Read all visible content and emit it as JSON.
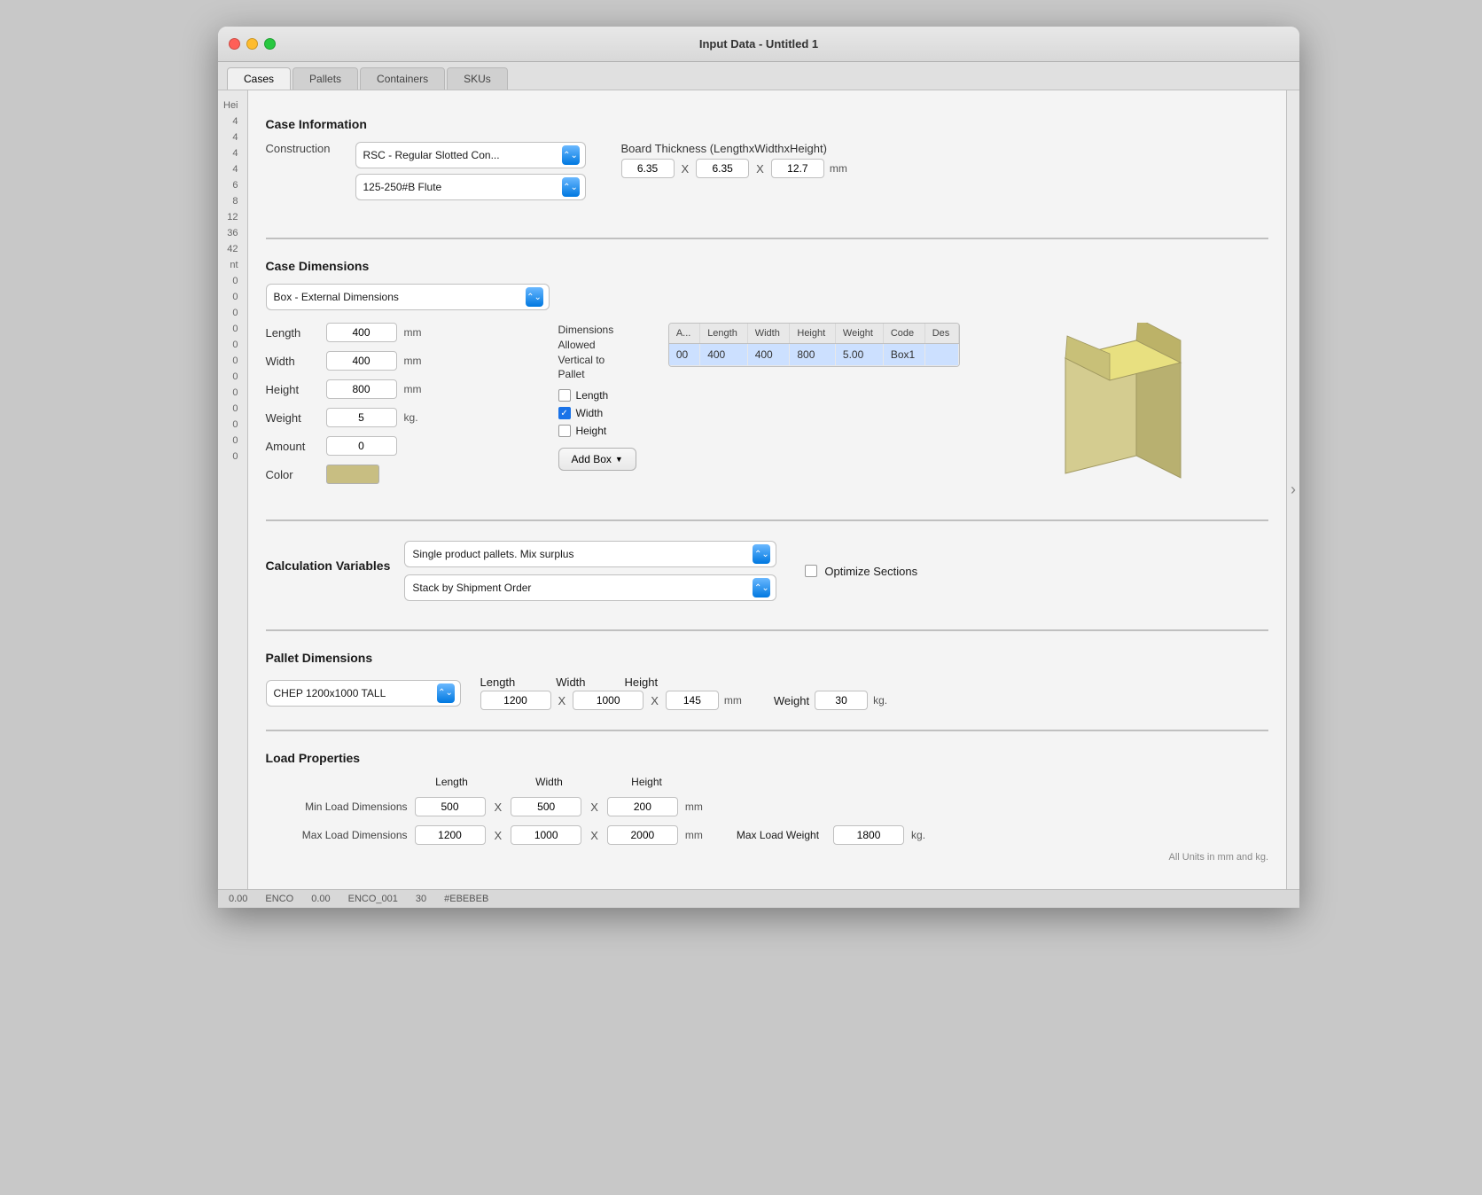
{
  "window": {
    "title": "Input Data - Untitled 1"
  },
  "tabs": [
    {
      "label": "Cases",
      "active": true
    },
    {
      "label": "Pallets",
      "active": false
    },
    {
      "label": "Containers",
      "active": false
    },
    {
      "label": "SKUs",
      "active": false
    }
  ],
  "caseInformation": {
    "header": "Case Information",
    "construction_label": "Construction",
    "construction_value": "RSC - Regular Slotted Con...",
    "flute_value": "125-250#B Flute",
    "board_thickness_label": "Board Thickness (LengthxWidthxHeight)",
    "thickness_l": "6.35",
    "thickness_w": "6.35",
    "thickness_h": "12.7",
    "thickness_unit": "mm",
    "x1": "X",
    "x2": "X"
  },
  "caseDimensions": {
    "header": "Case Dimensions",
    "box_dropdown": "Box - External Dimensions",
    "length_label": "Length",
    "width_label": "Width",
    "height_label": "Height",
    "weight_label": "Weight",
    "amount_label": "Amount",
    "color_label": "Color",
    "length_val": "400",
    "width_val": "400",
    "height_val": "800",
    "weight_val": "5",
    "amount_val": "0",
    "unit_mm": "mm",
    "unit_kg": "kg.",
    "dims_allowed_title": "Dimensions\nAllowed\nVertical to\nPallet",
    "check_length": "Length",
    "check_width": "Width",
    "check_height": "Height",
    "add_box_btn": "Add Box",
    "color_hex": "#c8be82"
  },
  "boxTable": {
    "columns": [
      "A...",
      "Length",
      "Width",
      "Height",
      "Weight",
      "Code",
      "Des"
    ],
    "rows": [
      {
        "a": "00",
        "length": "400",
        "width": "400",
        "height": "800",
        "weight": "5.00",
        "code": "Box1",
        "des": ""
      }
    ]
  },
  "calculationVariables": {
    "header": "Calculation Variables",
    "dropdown1": "Single product pallets. Mix surplus",
    "dropdown2": "Stack by Shipment Order",
    "optimize_label": "Optimize Sections"
  },
  "palletDimensions": {
    "header": "Pallet Dimensions",
    "pallet_type": "CHEP 1200x1000 TALL",
    "length_label": "Length",
    "width_label": "Width",
    "height_label": "Height",
    "length_val": "1200",
    "width_val": "1000",
    "height_val": "145",
    "unit": "mm",
    "weight_label": "Weight",
    "weight_val": "30",
    "weight_unit": "kg.",
    "x1": "X",
    "x2": "X"
  },
  "loadProperties": {
    "header": "Load Properties",
    "length_label": "Length",
    "width_label": "Width",
    "height_label": "Height",
    "min_label": "Min Load Dimensions",
    "max_label": "Max Load Dimensions",
    "min_l": "500",
    "min_w": "500",
    "min_h": "200",
    "max_l": "1200",
    "max_w": "1000",
    "max_h": "2000",
    "unit": "mm",
    "max_load_weight_label": "Max Load Weight",
    "max_load_weight_val": "1800",
    "weight_unit": "kg.",
    "x1": "X",
    "x2": "X",
    "x3": "X",
    "x4": "X",
    "note": "All Units in mm and kg."
  },
  "statusBar": {
    "val1": "0.00",
    "val2": "ENCO",
    "val3": "0.00",
    "val4": "ENCO_001",
    "val5": "30",
    "val6": "#EBEBEB"
  },
  "rowNumbers": [
    "Hei",
    "4",
    "4",
    "4",
    "4",
    "6",
    "8",
    "12",
    "36",
    "42",
    "nt",
    "",
    "",
    "",
    "",
    "",
    "",
    "",
    "",
    "",
    "",
    "",
    "",
    "",
    "",
    "",
    "",
    "",
    "",
    "",
    "",
    "",
    "0",
    "0",
    "0",
    "0",
    "0",
    "0",
    "0",
    "0",
    "0",
    "0",
    "0"
  ]
}
